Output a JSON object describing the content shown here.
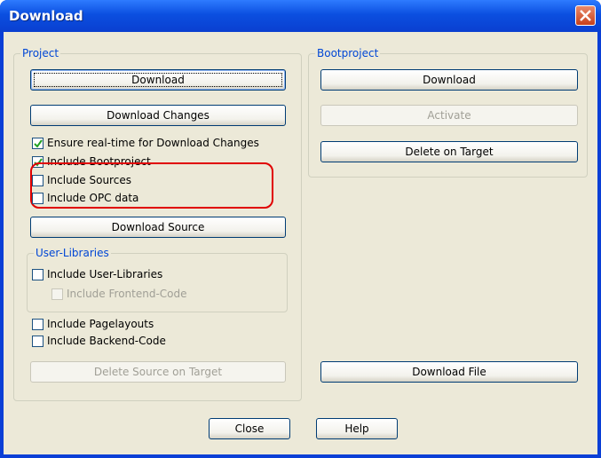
{
  "window": {
    "title": "Download"
  },
  "project": {
    "label": "Project",
    "download": "Download",
    "download_changes": "Download Changes",
    "ensure_realtime": "Ensure real-time for Download Changes",
    "include_bootproject": "Include Bootproject",
    "include_sources": "Include Sources",
    "include_opc": "Include OPC data",
    "download_source": "Download Source",
    "include_pagelayouts": "Include Pagelayouts",
    "include_backend": "Include Backend-Code",
    "delete_source": "Delete Source on Target"
  },
  "user_libraries": {
    "label": "User-Libraries",
    "include_user_libs": "Include User-Libraries",
    "include_frontend": "Include Frontend-Code"
  },
  "bootproject": {
    "label": "Bootproject",
    "download": "Download",
    "activate": "Activate",
    "delete_on_target": "Delete on Target",
    "download_file": "Download File"
  },
  "footer": {
    "close": "Close",
    "help": "Help"
  },
  "checks": {
    "ensure_realtime": true,
    "include_bootproject": true,
    "include_sources": false,
    "include_opc": false,
    "include_user_libs": false,
    "include_frontend": false,
    "include_pagelayouts": false,
    "include_backend": false
  },
  "colors": {
    "title_bar": "#0a3fd6",
    "dialog_bg": "#ece9d8",
    "group_label": "#0046d5",
    "highlight": "#e00000"
  }
}
